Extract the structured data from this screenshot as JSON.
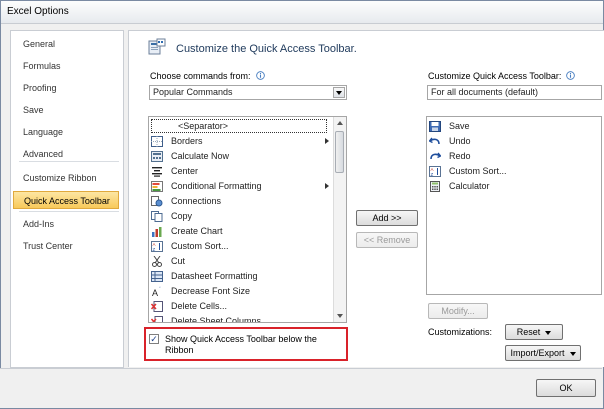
{
  "window": {
    "title": "Excel Options"
  },
  "sidebar": {
    "items": [
      {
        "label": "General"
      },
      {
        "label": "Formulas"
      },
      {
        "label": "Proofing"
      },
      {
        "label": "Save"
      },
      {
        "label": "Language"
      },
      {
        "label": "Advanced"
      },
      {
        "label": "Customize Ribbon"
      },
      {
        "label": "Quick Access Toolbar",
        "active": true
      },
      {
        "label": "Add-Ins"
      },
      {
        "label": "Trust Center"
      }
    ]
  },
  "header": {
    "title": "Customize the Quick Access Toolbar.",
    "icon": "quick-access-toolbar-icon"
  },
  "left_panel": {
    "label": "Choose commands from:",
    "combo_value": "Popular Commands",
    "items": [
      {
        "label": "Borders",
        "icon": "borders-icon",
        "submenu": true
      },
      {
        "label": "Calculate Now",
        "icon": "calculate-icon"
      },
      {
        "label": "Center",
        "icon": "center-align-icon"
      },
      {
        "label": "Conditional Formatting",
        "icon": "conditional-formatting-icon",
        "submenu": true
      },
      {
        "label": "Connections",
        "icon": "connections-icon"
      },
      {
        "label": "Copy",
        "icon": "copy-icon"
      },
      {
        "label": "Create Chart",
        "icon": "chart-icon"
      },
      {
        "label": "Custom Sort...",
        "icon": "sort-icon"
      },
      {
        "label": "Cut",
        "icon": "scissors-icon"
      },
      {
        "label": "Datasheet Formatting",
        "icon": "datasheet-icon"
      },
      {
        "label": "Decrease Font Size",
        "icon": "decrease-font-icon"
      },
      {
        "label": "Delete Cells...",
        "icon": "delete-cells-icon"
      },
      {
        "label": "Delete Sheet Columns",
        "icon": "delete-columns-icon"
      }
    ],
    "separator_label": "<Separator>"
  },
  "right_panel": {
    "label": "Customize Quick Access Toolbar:",
    "combo_value": "For all documents (default)",
    "items": [
      {
        "label": "Save",
        "icon": "save-icon"
      },
      {
        "label": "Undo",
        "icon": "undo-icon"
      },
      {
        "label": "Redo",
        "icon": "redo-icon"
      },
      {
        "label": "Custom Sort...",
        "icon": "sort-icon"
      },
      {
        "label": "Calculator",
        "icon": "calculator-icon"
      }
    ]
  },
  "buttons": {
    "add": "Add >>",
    "remove": "<< Remove",
    "modify": "Modify...",
    "reset": "Reset",
    "import_export": "Import/Export",
    "ok": "OK"
  },
  "customizations_label": "Customizations:",
  "show_below_ribbon": {
    "label": "Show Quick Access Toolbar below the Ribbon",
    "checked": true
  },
  "colors": {
    "highlight": "#d9222a",
    "active_item": "#f8c95a",
    "header_text": "#1e395b"
  }
}
